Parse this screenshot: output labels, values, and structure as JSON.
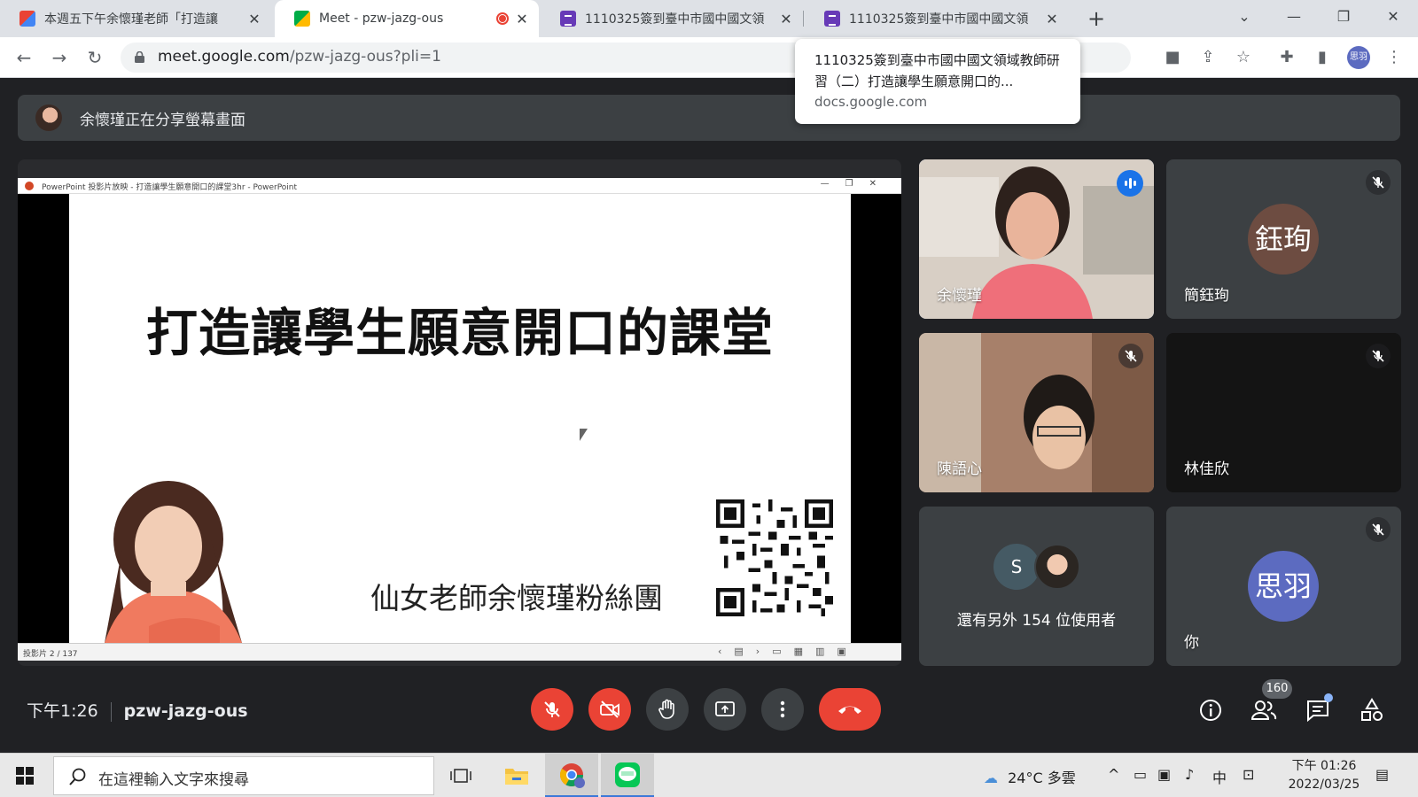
{
  "browser": {
    "tabs": [
      {
        "title": "本週五下午余懷瑾老師「打造讓",
        "favicon": "gmail-icon",
        "active": false
      },
      {
        "title": "Meet - pzw-jazg-ous",
        "favicon": "meet-icon",
        "active": true,
        "recording": true
      },
      {
        "title": "1110325簽到臺中市國中國文領",
        "favicon": "forms-icon",
        "active": false
      },
      {
        "title": "1110325簽到臺中市國中國文領",
        "favicon": "forms-icon",
        "active": false
      }
    ],
    "new_tab": "+",
    "url_host": "meet.google.com",
    "url_path": "/pzw-jazg-ous?pli=1",
    "profile_label": "思羽",
    "tooltip": {
      "title": "1110325簽到臺中市國中國文領域教師研習（二）打造讓學生願意開口的...",
      "domain": "docs.google.com"
    }
  },
  "meet": {
    "share_banner": "余懷瑾正在分享螢幕畫面",
    "ppt_window_title": "PowerPoint 投影片放映 - 打造讓學生願意開口的課堂3hr - PowerPoint",
    "slide_title": "打造讓學生願意開口的課堂",
    "slide_subtitle": "仙女老師余懷瑾粉絲團",
    "slide_counter": "投影片 2 / 137",
    "participants": [
      {
        "name": "余懷瑾",
        "speaking": true
      },
      {
        "name": "簡鈺珣",
        "avatar_text": "鈺珣",
        "avatar_color": "#6d4c41",
        "muted": true
      },
      {
        "name": "陳語心",
        "muted": true
      },
      {
        "name": "林佳欣",
        "muted": true
      },
      {
        "name": "你",
        "avatar_text": "思羽",
        "avatar_color": "#5c6bc0",
        "muted": true
      }
    ],
    "others": {
      "avatar_letter": "S",
      "text": "還有另外 154 位使用者"
    },
    "time": "下午1:26",
    "meeting_code": "pzw-jazg-ous",
    "people_count": "160",
    "colors": {
      "end_call": "#ea4335",
      "speaking": "#1a73e8"
    }
  },
  "taskbar": {
    "search_placeholder": "在這裡輸入文字來搜尋",
    "weather": "24°C 多雲",
    "ime": "中",
    "time": "下午 01:26",
    "date": "2022/03/25"
  }
}
